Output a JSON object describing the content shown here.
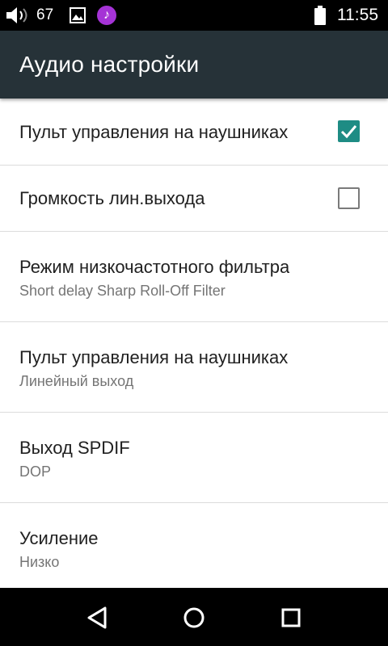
{
  "status_bar": {
    "volume_level": "67",
    "clock": "11:55",
    "icons": [
      "volume-icon",
      "image-icon",
      "music-icon",
      "battery-icon"
    ],
    "music_icon_color": "#a533d6"
  },
  "app_bar": {
    "title": "Аудио настройки",
    "background": "#263238"
  },
  "settings": [
    {
      "title": "Пульт управления на наушниках",
      "control": "checkbox",
      "checked": true
    },
    {
      "title": "Громкость лин.выхода",
      "control": "checkbox",
      "checked": false
    },
    {
      "title": "Режим низкочастотного фильтра",
      "summary": "Short delay Sharp Roll-Off Filter"
    },
    {
      "title": "Пульт управления на наушниках",
      "summary": "Линейный выход"
    },
    {
      "title": "Выход SPDIF",
      "summary": "DOP"
    },
    {
      "title": "Усиление",
      "summary": "Низко"
    }
  ],
  "accent_color": "#1e8c84",
  "nav_bar": {
    "buttons": [
      "back-icon",
      "home-icon",
      "recents-icon"
    ]
  }
}
